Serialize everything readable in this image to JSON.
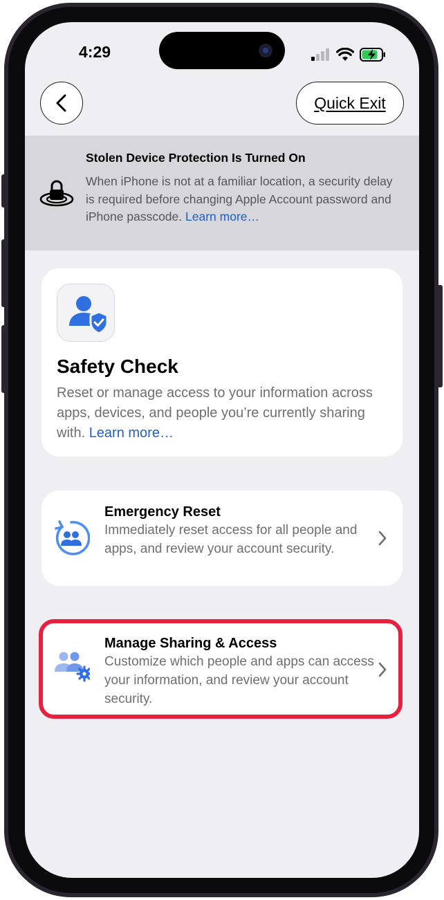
{
  "status_bar": {
    "time": "4:29"
  },
  "nav": {
    "back_icon": "chevron-left-icon",
    "quick_exit_label": "Quick Exit"
  },
  "banner": {
    "icon": "lock-icon",
    "title": "Stolen Device Protection Is Turned On",
    "body": "When iPhone is not at a familiar location, a security delay is required before changing Apple Account password and iPhone passcode.",
    "link": "Learn more…"
  },
  "safety_check": {
    "icon": "person-shield-icon",
    "title": "Safety Check",
    "body": "Reset or manage access to your information across apps, devices, and people you’re currently sharing with.",
    "link": "Learn more…"
  },
  "options": [
    {
      "icon": "emergency-reset-icon",
      "title": "Emergency Reset",
      "body": "Immediately reset access for all people and apps, and review your account security."
    },
    {
      "icon": "people-gear-icon",
      "title": "Manage Sharing & Access",
      "body": "Customize which people and apps can access your information, and review your account security."
    }
  ],
  "colors": {
    "accent": "#1f5fc7",
    "icon_blue": "#3b7de8",
    "highlight": "#e8203f",
    "background": "#efeef3"
  }
}
